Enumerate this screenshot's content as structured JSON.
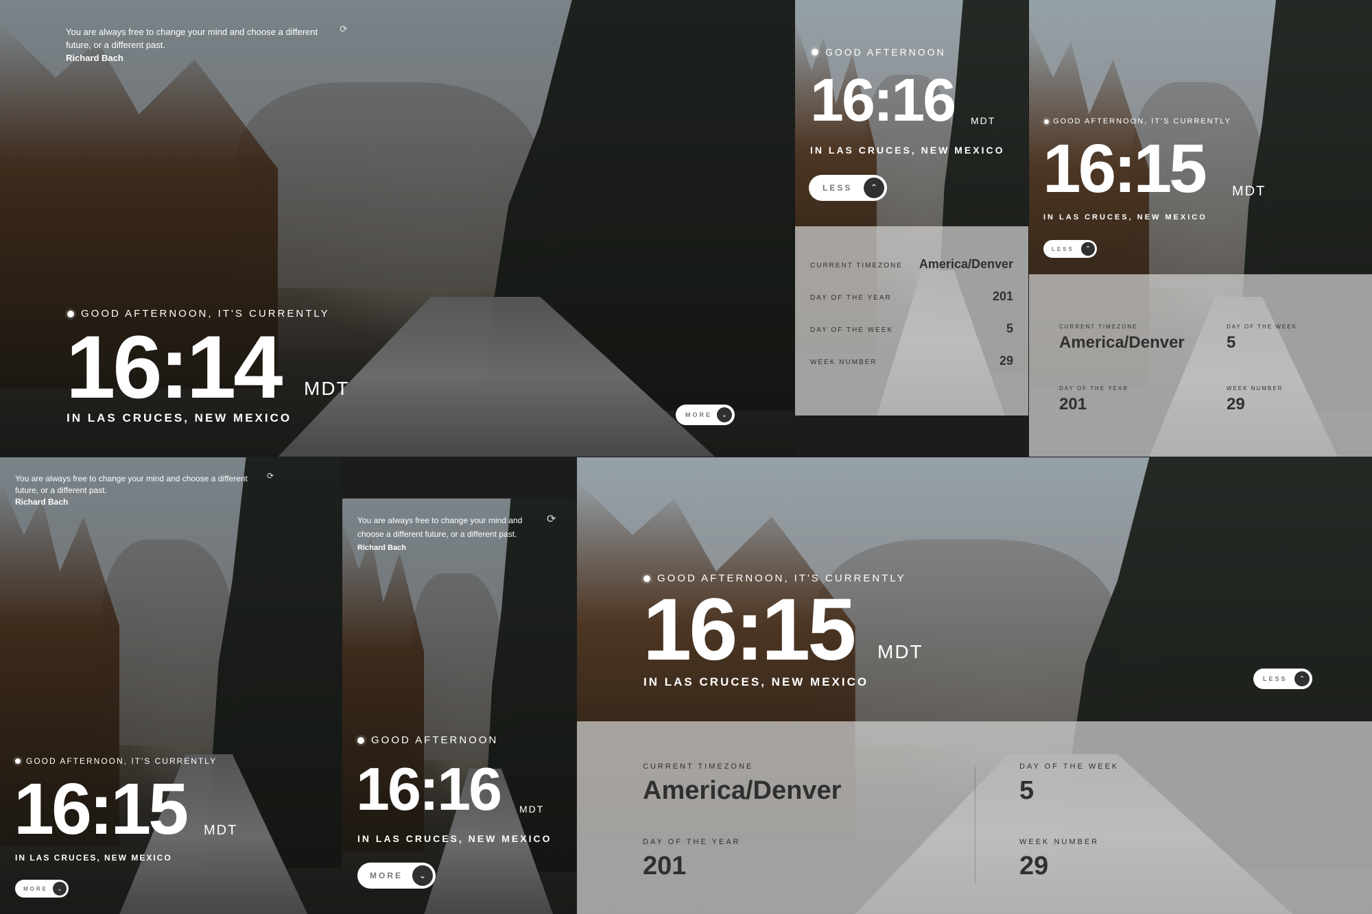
{
  "quote": {
    "text": "You are always free to change your mind and choose a different future, or a different past.",
    "author": "Richard Bach"
  },
  "greetings": {
    "long": "GOOD AFTERNOON, IT'S CURRENTLY",
    "short": "GOOD AFTERNOON"
  },
  "times": {
    "p1": "16:14",
    "p2": "16:16",
    "p3": "16:15",
    "p4": "16:15",
    "p5": "16:16",
    "p6": "16:15"
  },
  "timezone_abbr": "MDT",
  "location": "IN LAS CRUCES, NEW MEXICO",
  "buttons": {
    "more": "MORE",
    "less": "LESS"
  },
  "details": {
    "timezone_label": "CURRENT TIMEZONE",
    "timezone_value": "America/Denver",
    "day_of_year_label": "DAY OF THE YEAR",
    "day_of_year_value": "201",
    "day_of_week_label": "DAY OF THE WEEK",
    "day_of_week_value": "5",
    "week_number_label": "WEEK NUMBER",
    "week_number_value": "29"
  },
  "icons": {
    "refresh": "refresh-icon",
    "sun": "sun-icon",
    "chevron_down": "chevron-down-icon",
    "chevron_up": "chevron-up-icon"
  },
  "colors": {
    "button_circle": "#303030",
    "panel_overlay": "#d2d2d2",
    "text_dark": "#303030"
  }
}
